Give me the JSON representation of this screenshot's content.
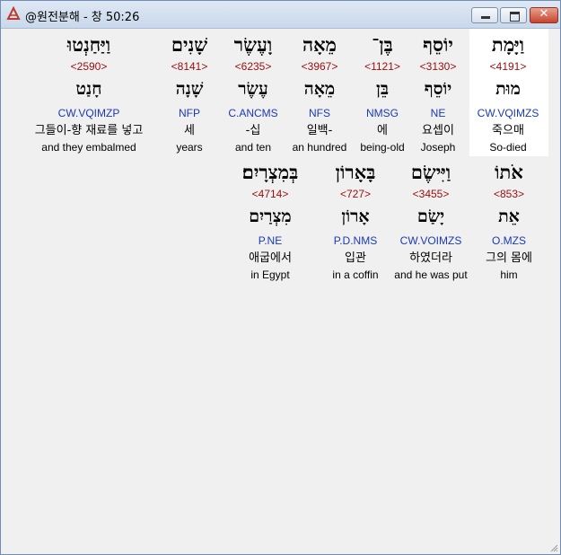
{
  "window": {
    "title": "@원전분해 - 창 50:26",
    "close_glyph": "✕"
  },
  "rows": [
    [
      {
        "hebrew": "וַיָּמָת",
        "strong": "<4191>",
        "lemma": "מוּת",
        "parsing": "CW.VQIMZS",
        "korean": "죽으매",
        "english": "So-died"
      },
      {
        "hebrew": "יוֹסֵף",
        "strong": "<3130>",
        "lemma": "יוֹסֵף",
        "parsing": "NE",
        "korean": "요셉이",
        "english": "Joseph"
      },
      {
        "hebrew": "בֶּן־",
        "strong": "<1121>",
        "lemma": "בֵּן",
        "parsing": "NMSG",
        "korean": "에",
        "english": "being-old"
      },
      {
        "hebrew": "מֵאָה",
        "strong": "<3967>",
        "lemma": "מֵאָה",
        "parsing": "NFS",
        "korean": "일백-",
        "english": "an hundred"
      },
      {
        "hebrew": "וָעֶשֶׂר",
        "strong": "<6235>",
        "lemma": "עֶשֶׂר",
        "parsing": "C.ANCMS",
        "korean": "-십",
        "english": "and ten"
      },
      {
        "hebrew": "שָׁנִים",
        "strong": "<8141>",
        "lemma": "שָׁנָה",
        "parsing": "NFP",
        "korean": "세",
        "english": "years"
      },
      {
        "hebrew": "וַיַּחַנְטוּ",
        "strong": "<2590>",
        "lemma": "חָנַט",
        "parsing": "CW.VQIMZP",
        "korean": "그들이-향 재료를 넣고",
        "english": "and they embalmed"
      }
    ],
    [
      {
        "hebrew": "אֹתוֹ",
        "strong": "<853>",
        "lemma": "אֵת",
        "parsing": "O.MZS",
        "korean": "그의 몸에",
        "english": "him"
      },
      {
        "hebrew": "וַיִּישֶׂם",
        "strong": "<3455>",
        "lemma": "יָשַׂם",
        "parsing": "CW.VOIMZS",
        "korean": "하였더라",
        "english": "and he was put"
      },
      {
        "hebrew": "בָּאָרוֹן",
        "strong": "<727>",
        "lemma": "אָרוֹן",
        "parsing": "P.D.NMS",
        "korean": "입관",
        "english": "in a coffin"
      },
      {
        "hebrew": "בְּמִצְרָיִם׃",
        "strong": "<4714>",
        "lemma": "מִצְרַיִם",
        "parsing": "P.NE",
        "korean": "애굽에서",
        "english": "in Egypt"
      }
    ]
  ]
}
